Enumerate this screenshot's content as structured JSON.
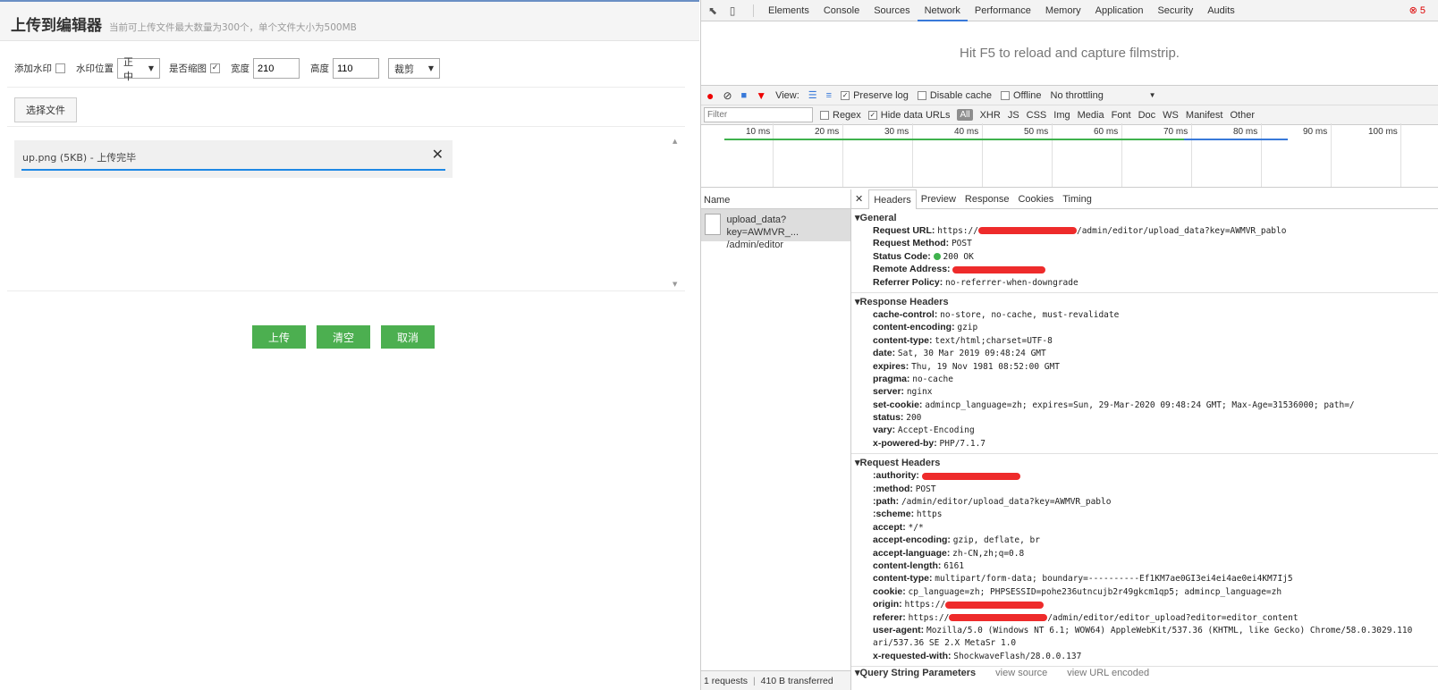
{
  "upload": {
    "title": "上传到编辑器",
    "subtitle": "当前可上传文件最大数量为300个，单个文件大小为500MB",
    "watermark_label": "添加水印",
    "position_label": "水印位置",
    "position_value": "正中",
    "thumb_label": "是否缩图",
    "width_label": "宽度",
    "width_value": "210",
    "height_label": "高度",
    "height_value": "110",
    "mode_value": "裁剪",
    "choose_label": "选择文件",
    "file_text": "up.png (5KB) - 上传完毕",
    "upload_btn": "上传",
    "clear_btn": "清空",
    "cancel_btn": "取消"
  },
  "devtools": {
    "tabs": [
      "Elements",
      "Console",
      "Sources",
      "Network",
      "Performance",
      "Memory",
      "Application",
      "Security",
      "Audits"
    ],
    "active_tab": "Network",
    "error_count": "5",
    "filmstrip_hint": "Hit F5 to reload and capture filmstrip.",
    "view_label": "View:",
    "preserve_log": "Preserve log",
    "disable_cache": "Disable cache",
    "offline": "Offline",
    "throttling": "No throttling",
    "filter_placeholder": "Filter",
    "regex": "Regex",
    "hide_data_urls": "Hide data URLs",
    "types": [
      "All",
      "XHR",
      "JS",
      "CSS",
      "Img",
      "Media",
      "Font",
      "Doc",
      "WS",
      "Manifest",
      "Other"
    ],
    "ticks": [
      "10 ms",
      "20 ms",
      "30 ms",
      "40 ms",
      "50 ms",
      "60 ms",
      "70 ms",
      "80 ms",
      "90 ms",
      "100 ms"
    ],
    "name_header": "Name",
    "request_name": "upload_data?key=AWMVR_...",
    "request_path": "/admin/editor",
    "footer_requests": "1 requests",
    "footer_transferred": "410 B transferred",
    "detail_tabs": [
      "Headers",
      "Preview",
      "Response",
      "Cookies",
      "Timing"
    ],
    "general_title": "General",
    "general": [
      {
        "k": "Request URL:",
        "v": "https://",
        "v2": "/admin/editor/upload_data?key=AWMVR_pablo"
      },
      {
        "k": "Request Method:",
        "v": "POST"
      },
      {
        "k": "Status Code:",
        "v": "200 OK"
      },
      {
        "k": "Remote Address:",
        "v": ""
      },
      {
        "k": "Referrer Policy:",
        "v": "no-referrer-when-downgrade"
      }
    ],
    "response_title": "Response Headers",
    "response": [
      {
        "k": "cache-control:",
        "v": "no-store, no-cache, must-revalidate"
      },
      {
        "k": "content-encoding:",
        "v": "gzip"
      },
      {
        "k": "content-type:",
        "v": "text/html;charset=UTF-8"
      },
      {
        "k": "date:",
        "v": "Sat, 30 Mar 2019 09:48:24 GMT"
      },
      {
        "k": "expires:",
        "v": "Thu, 19 Nov 1981 08:52:00 GMT"
      },
      {
        "k": "pragma:",
        "v": "no-cache"
      },
      {
        "k": "server:",
        "v": "nginx"
      },
      {
        "k": "set-cookie:",
        "v": "admincp_language=zh; expires=Sun, 29-Mar-2020 09:48:24 GMT; Max-Age=31536000; path=/"
      },
      {
        "k": "status:",
        "v": "200"
      },
      {
        "k": "vary:",
        "v": "Accept-Encoding"
      },
      {
        "k": "x-powered-by:",
        "v": "PHP/7.1.7"
      }
    ],
    "request_title": "Request Headers",
    "request": [
      {
        "k": ":authority:",
        "v": ""
      },
      {
        "k": ":method:",
        "v": "POST"
      },
      {
        "k": ":path:",
        "v": "/admin/editor/upload_data?key=AWMVR_pablo"
      },
      {
        "k": ":scheme:",
        "v": "https"
      },
      {
        "k": "accept:",
        "v": "*/*"
      },
      {
        "k": "accept-encoding:",
        "v": "gzip, deflate, br"
      },
      {
        "k": "accept-language:",
        "v": "zh-CN,zh;q=0.8"
      },
      {
        "k": "content-length:",
        "v": "6161"
      },
      {
        "k": "content-type:",
        "v": "multipart/form-data; boundary=----------Ef1KM7ae0GI3ei4ei4ae0ei4KM7Ij5"
      },
      {
        "k": "cookie:",
        "v": "cp_language=zh; PHPSESSID=pohe236utncujb2r49gkcm1qp5; admincp_language=zh"
      },
      {
        "k": "origin:",
        "v": "https://"
      },
      {
        "k": "referer:",
        "v": "https://",
        "v2": "/admin/editor/editor_upload?editor=editor_content"
      },
      {
        "k": "user-agent:",
        "v": "Mozilla/5.0 (Windows NT 6.1; WOW64) AppleWebKit/537.36 (KHTML, like Gecko) Chrome/58.0.3029.110"
      },
      {
        "k": "",
        "v": "ari/537.36 SE 2.X MetaSr 1.0"
      },
      {
        "k": "x-requested-with:",
        "v": "ShockwaveFlash/28.0.0.137"
      }
    ],
    "qsp_title": "Query String Parameters",
    "view_source": "view source",
    "view_url_encoded": "view URL encoded"
  }
}
